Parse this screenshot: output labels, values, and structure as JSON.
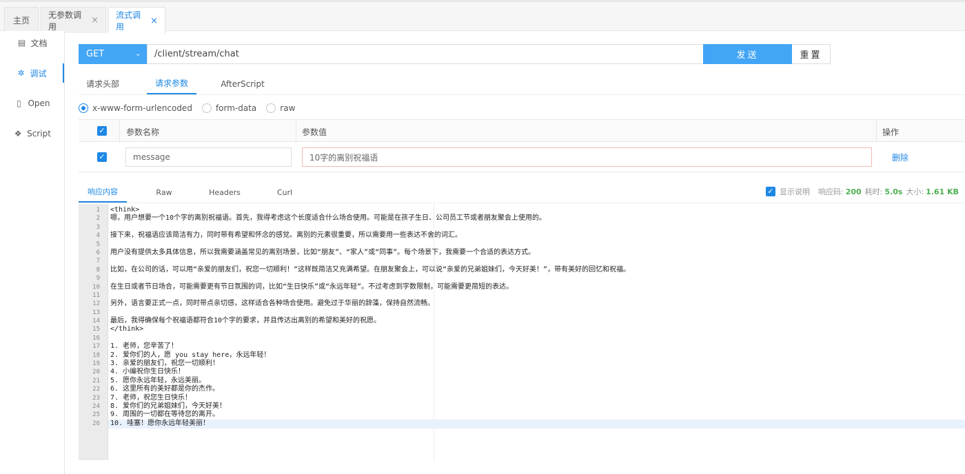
{
  "tabs": [
    {
      "label": "主页",
      "closable": false,
      "active": false
    },
    {
      "label": "无参数调用",
      "closable": true,
      "active": false
    },
    {
      "label": "流式调用",
      "closable": true,
      "active": true
    }
  ],
  "close_glyph": "×",
  "sidebar": {
    "items": [
      {
        "icon": "document-icon",
        "glyph": "▤",
        "label": "文档",
        "active": false
      },
      {
        "icon": "bug-icon",
        "glyph": "✲",
        "label": "调试",
        "active": true
      },
      {
        "icon": "file-icon",
        "glyph": "▯",
        "label": "Open",
        "active": false
      },
      {
        "icon": "script-icon",
        "glyph": "❖",
        "label": "Script",
        "active": false
      }
    ]
  },
  "request": {
    "method": "GET",
    "url": "/client/stream/chat",
    "send_label": "发送",
    "reset_label": "重置"
  },
  "request_tabs": [
    {
      "label": "请求头部",
      "active": false
    },
    {
      "label": "请求参数",
      "active": true
    },
    {
      "label": "AfterScript",
      "active": false
    }
  ],
  "body_types": [
    {
      "label": "x-www-form-urlencoded",
      "selected": true
    },
    {
      "label": "form-data",
      "selected": false
    },
    {
      "label": "raw",
      "selected": false
    }
  ],
  "params": {
    "headers": {
      "name": "参数名称",
      "value": "参数值",
      "action": "操作"
    },
    "rows": [
      {
        "checked": true,
        "name": "message",
        "value": "10字的离别祝福语",
        "action": "删除"
      }
    ]
  },
  "response_tabs": [
    {
      "label": "响应内容",
      "active": true
    },
    {
      "label": "Raw",
      "active": false
    },
    {
      "label": "Headers",
      "active": false
    },
    {
      "label": "Curl",
      "active": false
    }
  ],
  "response_info": {
    "show_desc_label": "显示说明",
    "show_desc_checked": true,
    "status_label": "响应码:",
    "status": "200",
    "time_label": "耗时:",
    "time": "5.0s",
    "size_label": "大小:",
    "size": "1.61 KB"
  },
  "editor": {
    "lines": [
      "<think>",
      "嗯，用户想要一个10个字的离别祝福语。首先，我得考虑这个长度适合什么场合使用。可能是在孩子生日、公司员工节或者朋友聚会上使用的。",
      "",
      "接下来，祝福语应该简洁有力，同时带有希望和怀念的感觉。离别的元素很重要，所以需要用一些表达不舍的词汇。",
      "",
      "用户没有提供太多具体信息，所以我需要涵盖常见的离别场景，比如“朋友”、“家人”或“同事”。每个场景下，我需要一个合适的表达方式。",
      "",
      "比如，在公司的话，可以用“亲爱的朋友们，祝您一切顺利！”这样既简洁又充满希望。在朋友聚会上，可以说“亲爱的兄弟姐妹们，今天好美！”，带有美好的回忆和祝福。",
      "",
      "在生日或者节日场合，可能需要更有节日氛围的词，比如“生日快乐”或“永远年轻”。不过考虑到字数限制，可能需要更简短的表达。",
      "",
      "另外，语言要正式一点，同时带点亲切感，这样适合各种场合使用。避免过于华丽的辞藻，保持自然流畅。",
      "",
      "最后，我得确保每个祝福语都符合10个字的要求，并且传达出离别的希望和美好的祝愿。",
      "</think>",
      "",
      "1. 老师，您辛苦了！",
      "2. 爱你们的人，愿 you stay here，永远年轻！",
      "3. 亲爱的朋友们，祝您一切顺利！",
      "4. 小编祝你生日快乐！",
      "5. 愿你永远年轻，永远美丽。",
      "6. 这里所有的美好都是你的杰作。",
      "7. 老师，祝您生日快乐！",
      "8. 爱你们的兄弟姐妹们，今天好美！",
      "9. 周围的一切都在等待您的离开。",
      "10. 哇塞！愿你永远年轻美丽！"
    ]
  },
  "colors": {
    "accent": "#1e88e5",
    "button": "#42a5f5",
    "success": "#4caf50"
  }
}
